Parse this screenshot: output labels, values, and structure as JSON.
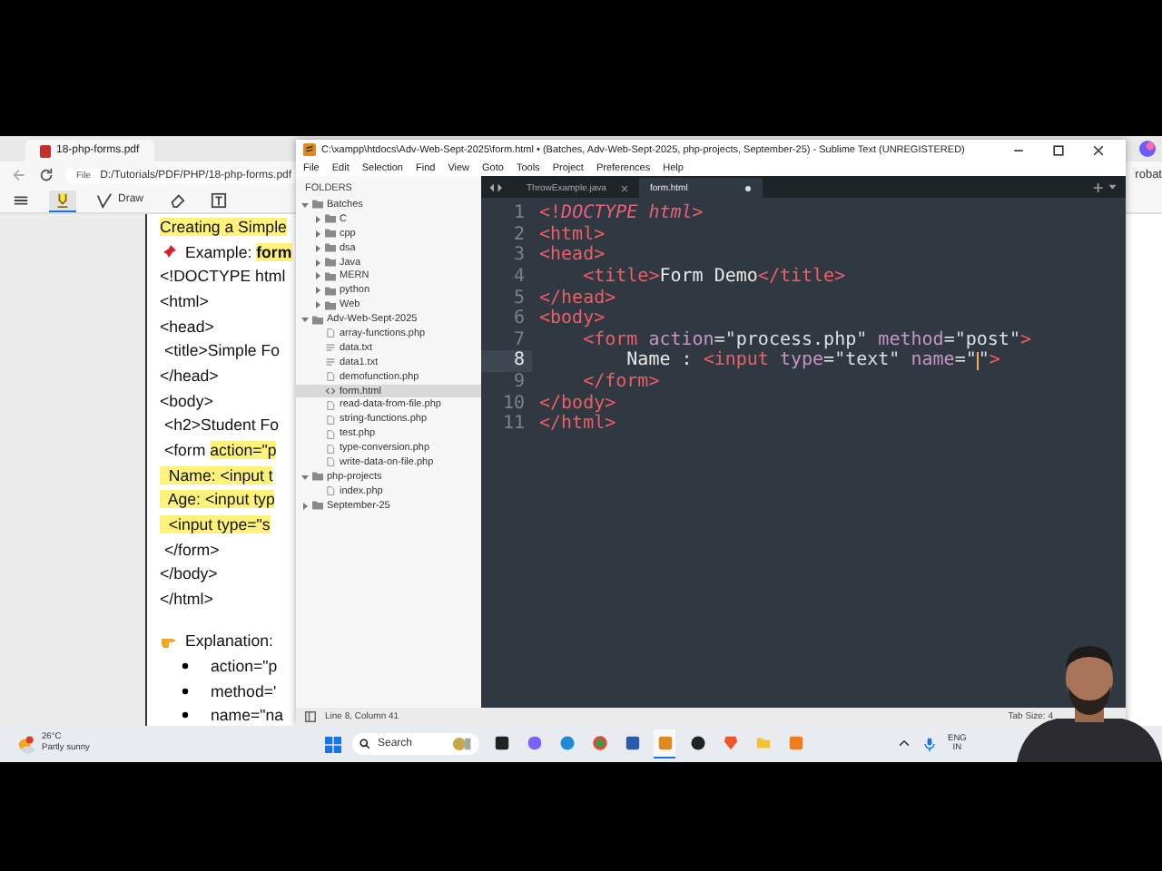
{
  "pdf_viewer": {
    "tab": {
      "title": "18-php-forms.pdf"
    },
    "address": {
      "scheme": "File",
      "path": "D:/Tutorials/PDF/PHP/18-php-forms.pdf"
    },
    "tools": [
      {
        "kind": "list",
        "selected": false
      },
      {
        "kind": "highlight",
        "selected": true
      },
      {
        "kind": "draw",
        "label": "Draw",
        "selected": false
      },
      {
        "kind": "erase",
        "selected": false
      },
      {
        "kind": "textbox",
        "selected": false
      }
    ],
    "side_label": "robat",
    "lines": [
      {
        "kind": "heading",
        "segments": [
          {
            "text": "Creating a Simple",
            "highlighted": true
          }
        ]
      },
      {
        "kind": "pin",
        "segments": [
          {
            "text": "Example: ",
            "highlighted": false
          },
          {
            "text": "**form**",
            "highlighted": true
          }
        ]
      },
      {
        "kind": "code",
        "segments": [
          {
            "text": "<!DOCTYPE html",
            "highlighted": false
          }
        ]
      },
      {
        "kind": "code",
        "segments": [
          {
            "text": "<html>",
            "highlighted": false
          }
        ]
      },
      {
        "kind": "code",
        "segments": [
          {
            "text": "<head>",
            "highlighted": false
          }
        ]
      },
      {
        "kind": "code",
        "segments": [
          {
            "text": " <title>Simple Fo",
            "highlighted": false
          }
        ]
      },
      {
        "kind": "code",
        "segments": [
          {
            "text": "</head>",
            "highlighted": false
          }
        ]
      },
      {
        "kind": "code",
        "segments": [
          {
            "text": "<body>",
            "highlighted": false
          }
        ]
      },
      {
        "kind": "code",
        "segments": [
          {
            "text": " <h2>Student Fo",
            "highlighted": false
          }
        ]
      },
      {
        "kind": "code",
        "segments": [
          {
            "text": " <form ",
            "highlighted": false
          },
          {
            "text": "action=\"p",
            "highlighted": true
          }
        ]
      },
      {
        "kind": "code",
        "segments": [
          {
            "text": "  Name: <input t",
            "highlighted": true
          }
        ]
      },
      {
        "kind": "code",
        "segments": [
          {
            "text": "  Age: <input typ",
            "highlighted": true
          }
        ]
      },
      {
        "kind": "code",
        "segments": [
          {
            "text": "  <input type=\"s",
            "highlighted": true
          }
        ]
      },
      {
        "kind": "code",
        "segments": [
          {
            "text": " </form>",
            "highlighted": false
          }
        ]
      },
      {
        "kind": "code",
        "segments": [
          {
            "text": "</body>",
            "highlighted": false
          }
        ]
      },
      {
        "kind": "code",
        "segments": [
          {
            "text": "</html>",
            "highlighted": false
          }
        ]
      },
      {
        "kind": "point",
        "segments": [
          {
            "text": "Explanation:",
            "highlighted": false
          }
        ]
      },
      {
        "kind": "bullet",
        "segments": [
          {
            "text": "action=\"p",
            "highlighted": false
          }
        ]
      },
      {
        "kind": "bullet",
        "segments": [
          {
            "text": "method='",
            "highlighted": false
          }
        ]
      },
      {
        "kind": "bullet",
        "segments": [
          {
            "text": "name=\"na",
            "highlighted": false
          }
        ]
      }
    ]
  },
  "editor": {
    "title": "C:\\xampp\\htdocs\\Adv-Web-Sept-2025\\form.html • (Batches, Adv-Web-Sept-2025, php-projects, September-25) - Sublime Text (UNREGISTERED)",
    "menu": [
      "File",
      "Edit",
      "Selection",
      "Find",
      "View",
      "Goto",
      "Tools",
      "Project",
      "Preferences",
      "Help"
    ],
    "sidebar": {
      "heading": "FOLDERS",
      "tree": [
        {
          "kind": "folder",
          "label": "Batches",
          "expanded": true,
          "selected": false,
          "children": [
            {
              "kind": "folder",
              "label": "C",
              "expanded": false,
              "selected": false
            },
            {
              "kind": "folder",
              "label": "cpp",
              "expanded": false,
              "selected": false
            },
            {
              "kind": "folder",
              "label": "dsa",
              "expanded": false,
              "selected": false
            },
            {
              "kind": "folder",
              "label": "Java",
              "expanded": false,
              "selected": false
            },
            {
              "kind": "folder",
              "label": "MERN",
              "expanded": false,
              "selected": false
            },
            {
              "kind": "folder",
              "label": "python",
              "expanded": false,
              "selected": false
            },
            {
              "kind": "folder",
              "label": "Web",
              "expanded": false,
              "selected": false
            }
          ]
        },
        {
          "kind": "folder",
          "label": "Adv-Web-Sept-2025",
          "expanded": true,
          "selected": false,
          "children": [
            {
              "kind": "file",
              "label": "array-functions.php",
              "selected": false
            },
            {
              "kind": "text",
              "label": "data.txt",
              "selected": false
            },
            {
              "kind": "text",
              "label": "data1.txt",
              "selected": false
            },
            {
              "kind": "file",
              "label": "demofunction.php",
              "selected": false
            },
            {
              "kind": "markup",
              "label": "form.html",
              "selected": true
            },
            {
              "kind": "file",
              "label": "read-data-from-file.php",
              "selected": false
            },
            {
              "kind": "file",
              "label": "string-functions.php",
              "selected": false
            },
            {
              "kind": "file",
              "label": "test.php",
              "selected": false
            },
            {
              "kind": "file",
              "label": "type-conversion.php",
              "selected": false
            },
            {
              "kind": "file",
              "label": "write-data-on-file.php",
              "selected": false
            }
          ]
        },
        {
          "kind": "folder",
          "label": "php-projects",
          "expanded": true,
          "selected": false,
          "children": [
            {
              "kind": "file",
              "label": "index.php",
              "selected": false
            }
          ]
        },
        {
          "kind": "folder",
          "label": "September-25",
          "expanded": false,
          "selected": false
        }
      ]
    },
    "tabs": [
      {
        "label": "ThrowExample.java",
        "selected": false
      },
      {
        "label": "form.html",
        "selected": true
      }
    ],
    "lines": [
      {
        "number": "1",
        "selected": false,
        "tokens": [
          {
            "kind": "tag",
            "text": "<!"
          },
          {
            "kind": "doctype",
            "text": "DOCTYPE html"
          },
          {
            "kind": "tag",
            "text": ">"
          }
        ]
      },
      {
        "number": "2",
        "selected": false,
        "tokens": [
          {
            "kind": "tag",
            "text": "<html>"
          }
        ]
      },
      {
        "number": "3",
        "selected": false,
        "tokens": [
          {
            "kind": "tag",
            "text": "<head>"
          }
        ]
      },
      {
        "number": "4",
        "selected": false,
        "tokens": [
          {
            "kind": "tag",
            "text": "    <title>"
          },
          {
            "kind": "text",
            "text": "Form Demo"
          },
          {
            "kind": "tag",
            "text": "</title>"
          }
        ]
      },
      {
        "number": "5",
        "selected": false,
        "tokens": [
          {
            "kind": "tag",
            "text": "</head>"
          }
        ]
      },
      {
        "number": "6",
        "selected": false,
        "tokens": [
          {
            "kind": "tag",
            "text": "<body>"
          }
        ]
      },
      {
        "number": "7",
        "selected": false,
        "tokens": [
          {
            "kind": "tag",
            "text": "    <form"
          },
          {
            "kind": "attr",
            "text": " action"
          },
          {
            "kind": "text",
            "text": "="
          },
          {
            "kind": "string",
            "text": "\"process.php\""
          },
          {
            "kind": "attr",
            "text": " method"
          },
          {
            "kind": "text",
            "text": "="
          },
          {
            "kind": "string",
            "text": "\"post\""
          },
          {
            "kind": "tag",
            "text": ">"
          }
        ]
      },
      {
        "number": "8",
        "selected": true,
        "tokens": [
          {
            "kind": "text",
            "text": "        Name : "
          },
          {
            "kind": "tag",
            "text": "<input"
          },
          {
            "kind": "attr",
            "text": " type"
          },
          {
            "kind": "text",
            "text": "="
          },
          {
            "kind": "string",
            "text": "\"text\""
          },
          {
            "kind": "attr",
            "text": " name"
          },
          {
            "kind": "text",
            "text": "="
          },
          {
            "kind": "string",
            "text": "\""
          },
          {
            "kind": "caret"
          },
          {
            "kind": "string",
            "text": "\""
          },
          {
            "kind": "tag",
            "text": ">"
          }
        ]
      },
      {
        "number": "9",
        "selected": false,
        "tokens": [
          {
            "kind": "tag",
            "text": "    </form>"
          }
        ]
      },
      {
        "number": "10",
        "selected": false,
        "tokens": [
          {
            "kind": "tag",
            "text": "</body>"
          }
        ]
      },
      {
        "number": "11",
        "selected": false,
        "tokens": [
          {
            "kind": "tag",
            "text": "</html>"
          }
        ]
      }
    ],
    "status": {
      "position": "Line 8, Column 41",
      "tab_size": "Tab Size: 4"
    }
  },
  "taskbar": {
    "weather": {
      "temperature": "26°C",
      "condition": "Partly sunny"
    },
    "search": {
      "placeholder": "Search"
    },
    "apps": [
      {
        "kind": "task-view",
        "selected": false
      },
      {
        "kind": "assistant",
        "selected": false
      },
      {
        "kind": "browser-wave",
        "selected": false
      },
      {
        "kind": "browser-ring",
        "selected": false
      },
      {
        "kind": "tiles",
        "selected": false
      },
      {
        "kind": "editor",
        "selected": true
      },
      {
        "kind": "dot-circle",
        "selected": false
      },
      {
        "kind": "shield",
        "selected": false
      },
      {
        "kind": "folder",
        "selected": false
      },
      {
        "kind": "cross",
        "selected": false
      }
    ],
    "tray": {
      "language": "ENG",
      "region": "IN"
    }
  }
}
